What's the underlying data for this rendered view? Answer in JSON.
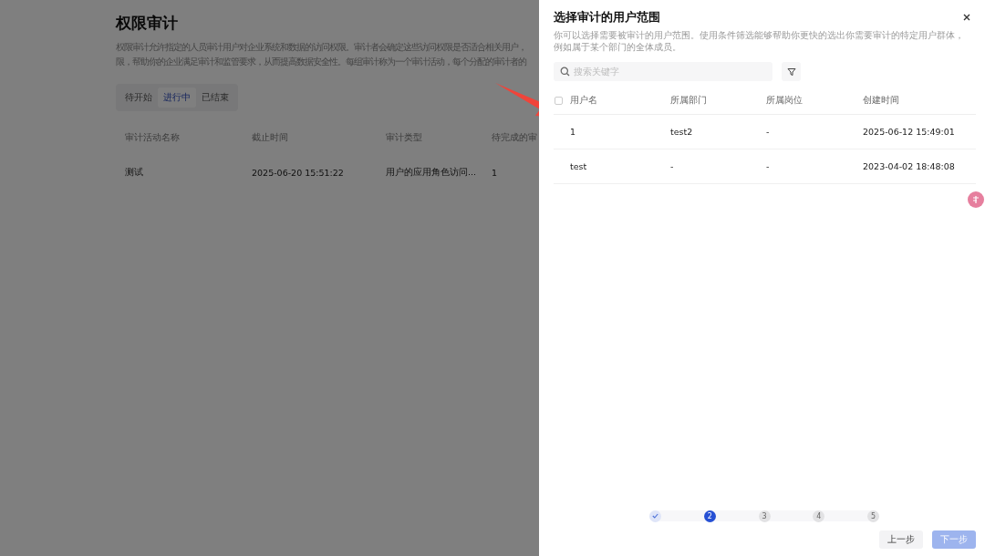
{
  "page": {
    "title": "权限审计",
    "description_lines": [
      "权限审计允许指定的人员审计用户对企业系统和数据的访问权限。审计者会确定这些访问权限是否适合相关用户，",
      "限，帮助你的企业满足审计和监管要求，从而提高数据安全性。每组审计称为一个审计活动，每个分配的审计者的"
    ],
    "tabs": [
      {
        "label": "待开始",
        "selected": false
      },
      {
        "label": "进行中",
        "selected": true
      },
      {
        "label": "已结束",
        "selected": false
      }
    ],
    "table": {
      "columns": [
        "审计活动名称",
        "截止时间",
        "审计类型",
        "待完成的审"
      ],
      "rows": [
        [
          "测试",
          "2025-06-20 15:51:22",
          "用户的应用角色访问...",
          "1"
        ]
      ]
    }
  },
  "drawer": {
    "title": "选择审计的用户范围",
    "description": "你可以选择需要被审计的用户范围。使用条件筛选能够帮助你更快的选出你需要审计的特定用户群体，例如属于某个部门的全体成员。",
    "search": {
      "placeholder": "搜索关键字"
    },
    "table": {
      "select_all": {
        "checked": false
      },
      "columns": [
        "用户名",
        "所属部门",
        "所属岗位",
        "创建时间"
      ],
      "rows": [
        [
          "1",
          "test2",
          "-",
          "2025-06-12 15:49:01"
        ],
        [
          "test",
          "-",
          "-",
          "2023-04-02 18:48:08"
        ]
      ]
    },
    "steps": [
      {
        "done": true,
        "current": false
      },
      {
        "label": "2",
        "done": false,
        "current": true
      },
      {
        "label": "3",
        "done": false,
        "current": false
      },
      {
        "label": "4",
        "done": false,
        "current": false
      },
      {
        "label": "5",
        "done": false,
        "current": false
      }
    ],
    "buttons": [
      {
        "label": "上一步",
        "disabled": false
      },
      {
        "label": "下一步",
        "disabled": true
      }
    ]
  }
}
